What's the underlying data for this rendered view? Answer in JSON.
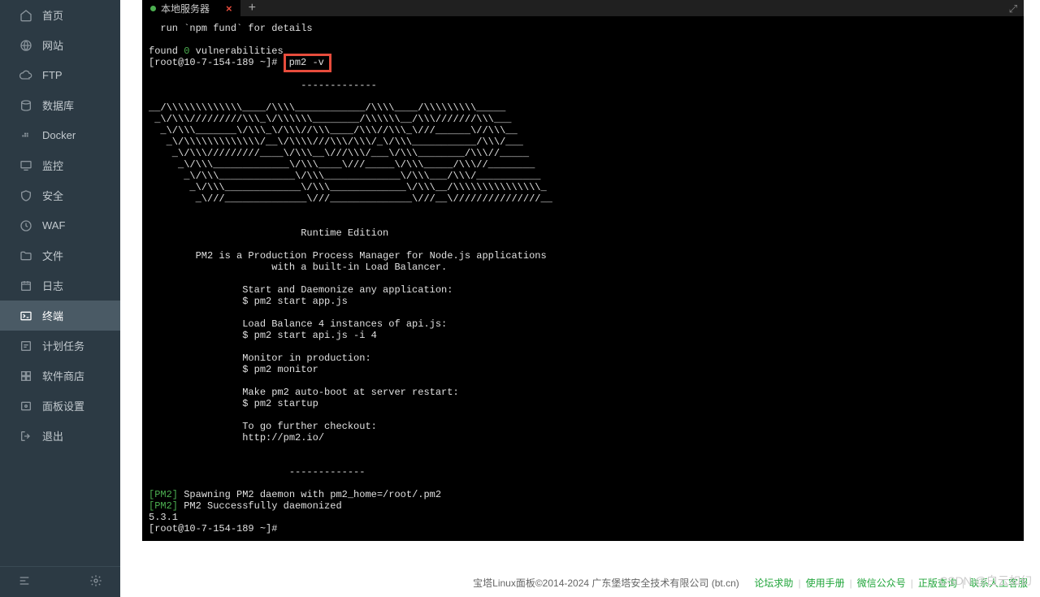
{
  "sidebar": {
    "items": [
      {
        "id": "home",
        "label": "首页",
        "active": false
      },
      {
        "id": "site",
        "label": "网站",
        "active": false
      },
      {
        "id": "ftp",
        "label": "FTP",
        "active": false
      },
      {
        "id": "db",
        "label": "数据库",
        "active": false
      },
      {
        "id": "docker",
        "label": "Docker",
        "active": false
      },
      {
        "id": "monitor",
        "label": "监控",
        "active": false
      },
      {
        "id": "security",
        "label": "安全",
        "active": false
      },
      {
        "id": "waf",
        "label": "WAF",
        "active": false
      },
      {
        "id": "files",
        "label": "文件",
        "active": false
      },
      {
        "id": "logs",
        "label": "日志",
        "active": false
      },
      {
        "id": "terminal",
        "label": "终端",
        "active": true
      },
      {
        "id": "cron",
        "label": "计划任务",
        "active": false
      },
      {
        "id": "appstore",
        "label": "软件商店",
        "active": false
      },
      {
        "id": "panel",
        "label": "面板设置",
        "active": false
      },
      {
        "id": "exit",
        "label": "退出",
        "active": false
      }
    ]
  },
  "tab": {
    "title": "本地服务器",
    "add": "+"
  },
  "terminal": {
    "line_fund": "  run `npm fund` for details",
    "found": "found ",
    "zero": "0",
    "vuln": " vulnerabilities",
    "prompt1": "[root@10-7-154-189 ~]# ",
    "cmd": "pm2 -v",
    "ascii": "                          -------------\n\n__/\\\\\\\\\\\\\\\\\\\\\\\\\\____/\\\\\\\\____________/\\\\\\\\____/\\\\\\\\\\\\\\\\\\_____\n _\\/\\\\\\/////////\\\\\\_\\/\\\\\\\\\\\\________/\\\\\\\\\\\\__/\\\\\\///////\\\\\\___\n  _\\/\\\\\\_______\\/\\\\\\_\\/\\\\\\//\\\\\\____/\\\\\\//\\\\\\_\\///______\\//\\\\\\__\n   _\\/\\\\\\\\\\\\\\\\\\\\\\\\\\/__\\/\\\\\\\\///\\\\\\/\\\\\\/_\\/\\\\\\___________/\\\\\\/___\n    _\\/\\\\\\/////////____\\/\\\\\\__\\///\\\\\\/___\\/\\\\\\________/\\\\\\//_____\n     _\\/\\\\\\_____________\\/\\\\\\____\\///_____\\/\\\\\\_____/\\\\\\//________\n      _\\/\\\\\\_____________\\/\\\\\\_____________\\/\\\\\\___/\\\\\\/___________\n       _\\/\\\\\\_____________\\/\\\\\\_____________\\/\\\\\\__/\\\\\\\\\\\\\\\\\\\\\\\\\\\\\\_\n        _\\///______________\\///______________\\///__\\///////////////__",
    "runtime": "                          Runtime Edition",
    "desc1": "        PM2 is a Production Process Manager for Node.js applications",
    "desc2": "                     with a built-in Load Balancer.",
    "l1": "                Start and Daemonize any application:",
    "l2": "                $ pm2 start app.js",
    "l3": "                Load Balance 4 instances of api.js:",
    "l4": "                $ pm2 start api.js -i 4",
    "l5": "                Monitor in production:",
    "l6": "                $ pm2 monitor",
    "l7": "                Make pm2 auto-boot at server restart:",
    "l8": "                $ pm2 startup",
    "l9": "                To go further checkout:",
    "l10": "                http://pm2.io/",
    "dash2": "                        -------------",
    "pm2": "[PM2]",
    "spawn": " Spawning PM2 daemon with pm2_home=/root/.pm2",
    "daemon": " PM2 Successfully daemonized",
    "ver": "5.3.1",
    "prompt2": "[root@10-7-154-189 ~]# "
  },
  "footer": {
    "copyright": "宝塔Linux面板©2014-2024 广东堡塔安全技术有限公司 (bt.cn)",
    "links": [
      "论坛求助",
      "使用手册",
      "微信公众号",
      "正版查询",
      "联系人工客服"
    ],
    "sep": "|"
  },
  "watermark": "CSDN @白云如幻"
}
